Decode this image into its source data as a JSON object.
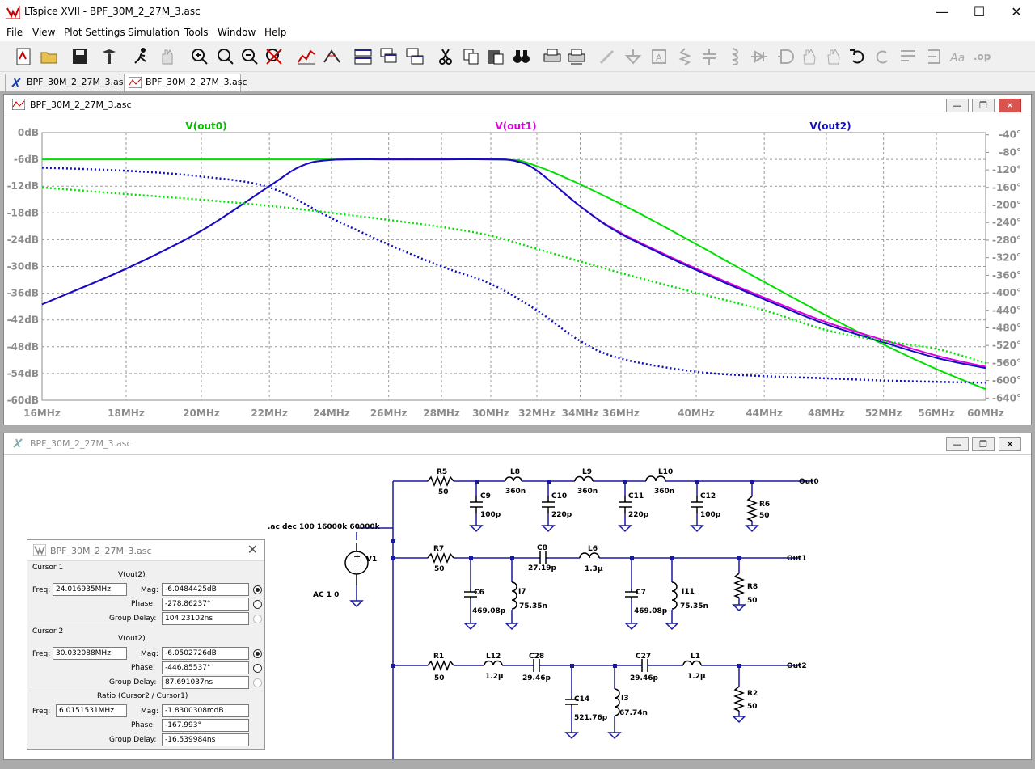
{
  "app": {
    "title": "LTspice XVII - BPF_30M_2_27M_3.asc"
  },
  "menu": [
    "File",
    "View",
    "Plot Settings",
    "Simulation",
    "Tools",
    "Window",
    "Help"
  ],
  "tabs": [
    {
      "label": "BPF_30M_2_27M_3.asc",
      "active": false
    },
    {
      "label": "BPF_30M_2_27M_3.asc",
      "active": true
    }
  ],
  "plot_window": {
    "title": "BPF_30M_2_27M_3.asc",
    "traces": [
      {
        "name": "V(out0)",
        "color": "#00e000"
      },
      {
        "name": "V(out1)",
        "color": "#e000e0"
      },
      {
        "name": "V(out2)",
        "color": "#1010c0"
      }
    ]
  },
  "chart_data": {
    "type": "line",
    "x_scale": "log",
    "xlim": [
      16,
      60
    ],
    "x_ticks": [
      "16MHz",
      "18MHz",
      "20MHz",
      "22MHz",
      "24MHz",
      "26MHz",
      "28MHz",
      "30MHz",
      "32MHz",
      "34MHz",
      "36MHz",
      "40MHz",
      "44MHz",
      "48MHz",
      "52MHz",
      "56MHz",
      "60MHz"
    ],
    "y_left_ticks": [
      "0dB",
      "-6dB",
      "-12dB",
      "-18dB",
      "-24dB",
      "-30dB",
      "-36dB",
      "-42dB",
      "-48dB",
      "-54dB",
      "-60dB"
    ],
    "y_right_ticks": [
      "-40°",
      "-80°",
      "-120°",
      "-160°",
      "-200°",
      "-240°",
      "-280°",
      "-320°",
      "-360°",
      "-400°",
      "-440°",
      "-480°",
      "-520°",
      "-560°",
      "-600°",
      "-640°"
    ],
    "ylim_mag": [
      -60,
      0
    ],
    "ylim_phase": [
      -645,
      -35
    ],
    "grid": true,
    "series": [
      {
        "name": "V(out0)",
        "kind": "magnitude",
        "x": [
          16,
          24,
          30,
          32,
          36,
          40,
          44,
          48,
          52,
          56,
          60
        ],
        "y": [
          -6.0,
          -6.0,
          -6.0,
          -7.5,
          -16,
          -25,
          -33.5,
          -41,
          -47.5,
          -53,
          -57.5
        ]
      },
      {
        "name": "V(out1)",
        "kind": "magnitude",
        "x": [
          16,
          18,
          20,
          22,
          23,
          24,
          26,
          28,
          30,
          31,
          32,
          34,
          36,
          40,
          44,
          48,
          52,
          56,
          60
        ],
        "y": [
          -38.5,
          -30.5,
          -22,
          -12,
          -7.5,
          -6.1,
          -6.0,
          -6.0,
          -6.0,
          -6.3,
          -8.5,
          -16.5,
          -22.5,
          -30.5,
          -37,
          -42.5,
          -46.5,
          -50,
          -52.5
        ]
      },
      {
        "name": "V(out2)",
        "kind": "magnitude",
        "x": [
          16,
          18,
          20,
          22,
          23,
          24,
          26,
          28,
          30,
          31,
          32,
          34,
          36,
          40,
          44,
          48,
          52,
          56,
          60
        ],
        "y": [
          -38.5,
          -30.5,
          -22,
          -12,
          -7.5,
          -6.1,
          -6.0,
          -6.0,
          -6.0,
          -6.3,
          -8.5,
          -16.5,
          -22.7,
          -30.8,
          -37.4,
          -43,
          -47,
          -50.5,
          -52.8
        ]
      },
      {
        "name": "V(out0)",
        "kind": "phase",
        "x": [
          16,
          18,
          20,
          22,
          24,
          26,
          28,
          30,
          32,
          36,
          40,
          44,
          48,
          52,
          56,
          60
        ],
        "y": [
          -160,
          -175,
          -188,
          -202,
          -218,
          -234,
          -250,
          -270,
          -300,
          -355,
          -400,
          -440,
          -485,
          -510,
          -528,
          -560
        ]
      },
      {
        "name": "V(out2)",
        "kind": "phase",
        "x": [
          16,
          18,
          20,
          22,
          24,
          26,
          28,
          30,
          32,
          34,
          36,
          40,
          44,
          48,
          52,
          56,
          60
        ],
        "y": [
          -115,
          -122,
          -135,
          -160,
          -230,
          -290,
          -340,
          -380,
          -440,
          -510,
          -550,
          -580,
          -590,
          -595,
          -600,
          -603,
          -605
        ]
      }
    ]
  },
  "schematic_window": {
    "title": "BPF_30M_2_27M_3.asc",
    "directive": ".ac dec 100 16000k 60000k",
    "source": {
      "name": "V1",
      "value": "AC 1 0"
    },
    "outputs": [
      "Out0",
      "Out1",
      "Out2"
    ],
    "components": [
      {
        "ref": "R5",
        "value": "50"
      },
      {
        "ref": "L8",
        "value": "360n"
      },
      {
        "ref": "L9",
        "value": "360n"
      },
      {
        "ref": "L10",
        "value": "360n"
      },
      {
        "ref": "C9",
        "value": "100p"
      },
      {
        "ref": "C10",
        "value": "220p"
      },
      {
        "ref": "C11",
        "value": "220p"
      },
      {
        "ref": "C12",
        "value": "100p"
      },
      {
        "ref": "R6",
        "value": "50"
      },
      {
        "ref": "R7",
        "value": "50"
      },
      {
        "ref": "C8",
        "value": "27.19p"
      },
      {
        "ref": "L6",
        "value": "1.3µ"
      },
      {
        "ref": "C6",
        "value": "469.08p"
      },
      {
        "ref": "I7",
        "value": "75.35n"
      },
      {
        "ref": "C7",
        "value": "469.08p"
      },
      {
        "ref": "I11",
        "value": "75.35n"
      },
      {
        "ref": "R8",
        "value": "50"
      },
      {
        "ref": "R1",
        "value": "50"
      },
      {
        "ref": "L12",
        "value": "1.2µ"
      },
      {
        "ref": "C28",
        "value": "29.46p"
      },
      {
        "ref": "C27",
        "value": "29.46p"
      },
      {
        "ref": "L1",
        "value": "1.2µ"
      },
      {
        "ref": "C14",
        "value": "521.76p"
      },
      {
        "ref": "I3",
        "value": "67.74n"
      },
      {
        "ref": "R2",
        "value": "50"
      }
    ]
  },
  "cursor_window": {
    "title": "BPF_30M_2_27M_3.asc",
    "cursor1": {
      "label": "Cursor 1",
      "trace": "V(out2)",
      "freq_label": "Freq:",
      "freq": "24.016935MHz",
      "mag_label": "Mag:",
      "mag": "-6.0484425dB",
      "phase_label": "Phase:",
      "phase": "-278.86237°",
      "gd_label": "Group Delay:",
      "gd": "104.23102ns"
    },
    "cursor2": {
      "label": "Cursor 2",
      "trace": "V(out2)",
      "freq_label": "Freq:",
      "freq": "30.032088MHz",
      "mag_label": "Mag:",
      "mag": "-6.0502726dB",
      "phase_label": "Phase:",
      "phase": "-446.85537°",
      "gd_label": "Group Delay:",
      "gd": "87.691037ns"
    },
    "ratio": {
      "label": "Ratio (Cursor2 / Cursor1)",
      "freq_label": "Freq:",
      "freq": "6.0151531MHz",
      "mag_label": "Mag:",
      "mag": "-1.8300308mdB",
      "phase_label": "Phase:",
      "phase": "-167.993°",
      "gd_label": "Group Delay:",
      "gd": "-16.539984ns"
    }
  }
}
